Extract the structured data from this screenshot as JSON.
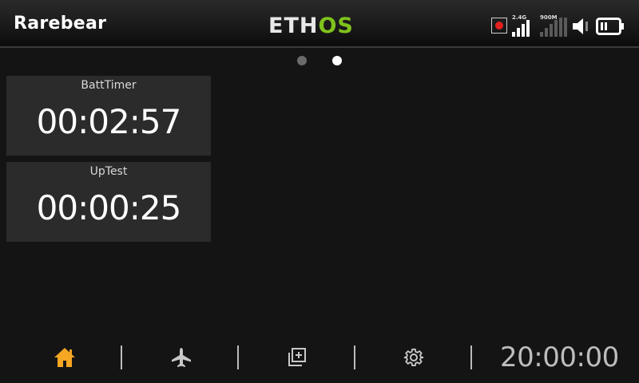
{
  "header": {
    "model_name": "Rarebear",
    "logo_eth": "ETH",
    "logo_os": "OS",
    "status": {
      "record_icon": "record-icon",
      "signal_24g_label": "2.4G",
      "signal_900m_label": "900M",
      "signal_24g_level": 0.5,
      "signal_900m_level": 0.0,
      "volume_icon": "speaker-icon",
      "battery_icon": "battery-icon",
      "battery_level": 0.4
    },
    "colors": {
      "logo_accent": "#7fc31c",
      "record": "#e41f1f"
    }
  },
  "pager": {
    "pages": 2,
    "active_page": 2
  },
  "widgets": [
    {
      "title": "BattTimer",
      "value": "00:02:57"
    },
    {
      "title": "UpTest",
      "value": "00:00:25"
    }
  ],
  "bottom_nav": {
    "items": [
      {
        "icon": "home-icon",
        "active": true
      },
      {
        "icon": "airplane-icon",
        "active": false
      },
      {
        "icon": "add-layout-icon",
        "active": false
      },
      {
        "icon": "gear-icon",
        "active": false
      }
    ],
    "clock": "20:00:00",
    "active_color": "#f5a623"
  }
}
